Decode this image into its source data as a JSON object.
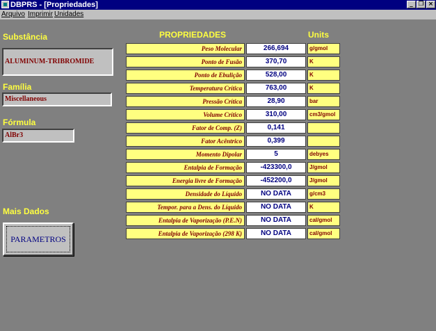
{
  "window": {
    "title": "DBPRS - [Propriedades]"
  },
  "menu": {
    "items": [
      "Arquivo",
      "Imprimir",
      "Unidades"
    ]
  },
  "left": {
    "substancia_label": "Substância",
    "substancia_value": "ALUMINUM-TRIBROMIDE",
    "familia_label": "Família",
    "familia_value": "Miscellaneous",
    "formula_label": "Fórmula",
    "formula_value": "AlBr3",
    "mais_dados_label": "Mais Dados",
    "parametros_button": "PARAMETROS"
  },
  "table": {
    "header_propriedades": "PROPRIEDADES",
    "header_units": "Units",
    "rows": [
      {
        "label": "Peso Molecular",
        "value": "266,694",
        "unit": "g/gmol"
      },
      {
        "label": "Ponto de Fusão",
        "value": "370,70",
        "unit": "K"
      },
      {
        "label": "Ponto de Ebulição",
        "value": "528,00",
        "unit": "K"
      },
      {
        "label": "Temperatura Crítica",
        "value": "763,00",
        "unit": "K"
      },
      {
        "label": "Pressão Crítica",
        "value": "28,90",
        "unit": "bar"
      },
      {
        "label": "Volume Crítico",
        "value": "310,00",
        "unit": "cm3/gmol"
      },
      {
        "label": "Fator de Comp. (Z)",
        "value": "0,141",
        "unit": ""
      },
      {
        "label": "Fator Acêntrico",
        "value": "0,399",
        "unit": ""
      },
      {
        "label": "Momento Dipolar",
        "value": "5",
        "unit": "debyes"
      },
      {
        "label": "Entalpia de Formação",
        "value": "-423300,0",
        "unit": "J/gmol"
      },
      {
        "label": "Energia livre de Formação",
        "value": "-452200,0",
        "unit": "J/gmol"
      },
      {
        "label": "Densidade do Líquido",
        "value": "NO DATA",
        "unit": "g/cm3"
      },
      {
        "label": "Tempor. para a Dens. do Líquido",
        "value": "NO DATA",
        "unit": "K"
      },
      {
        "label": "Entalpia de Vaporização (P.E.N)",
        "value": "NO DATA",
        "unit": "cal/gmol"
      },
      {
        "label": "Entalpia de Vaporização (298 K)",
        "value": "NO DATA",
        "unit": "cal/gmol"
      }
    ]
  }
}
